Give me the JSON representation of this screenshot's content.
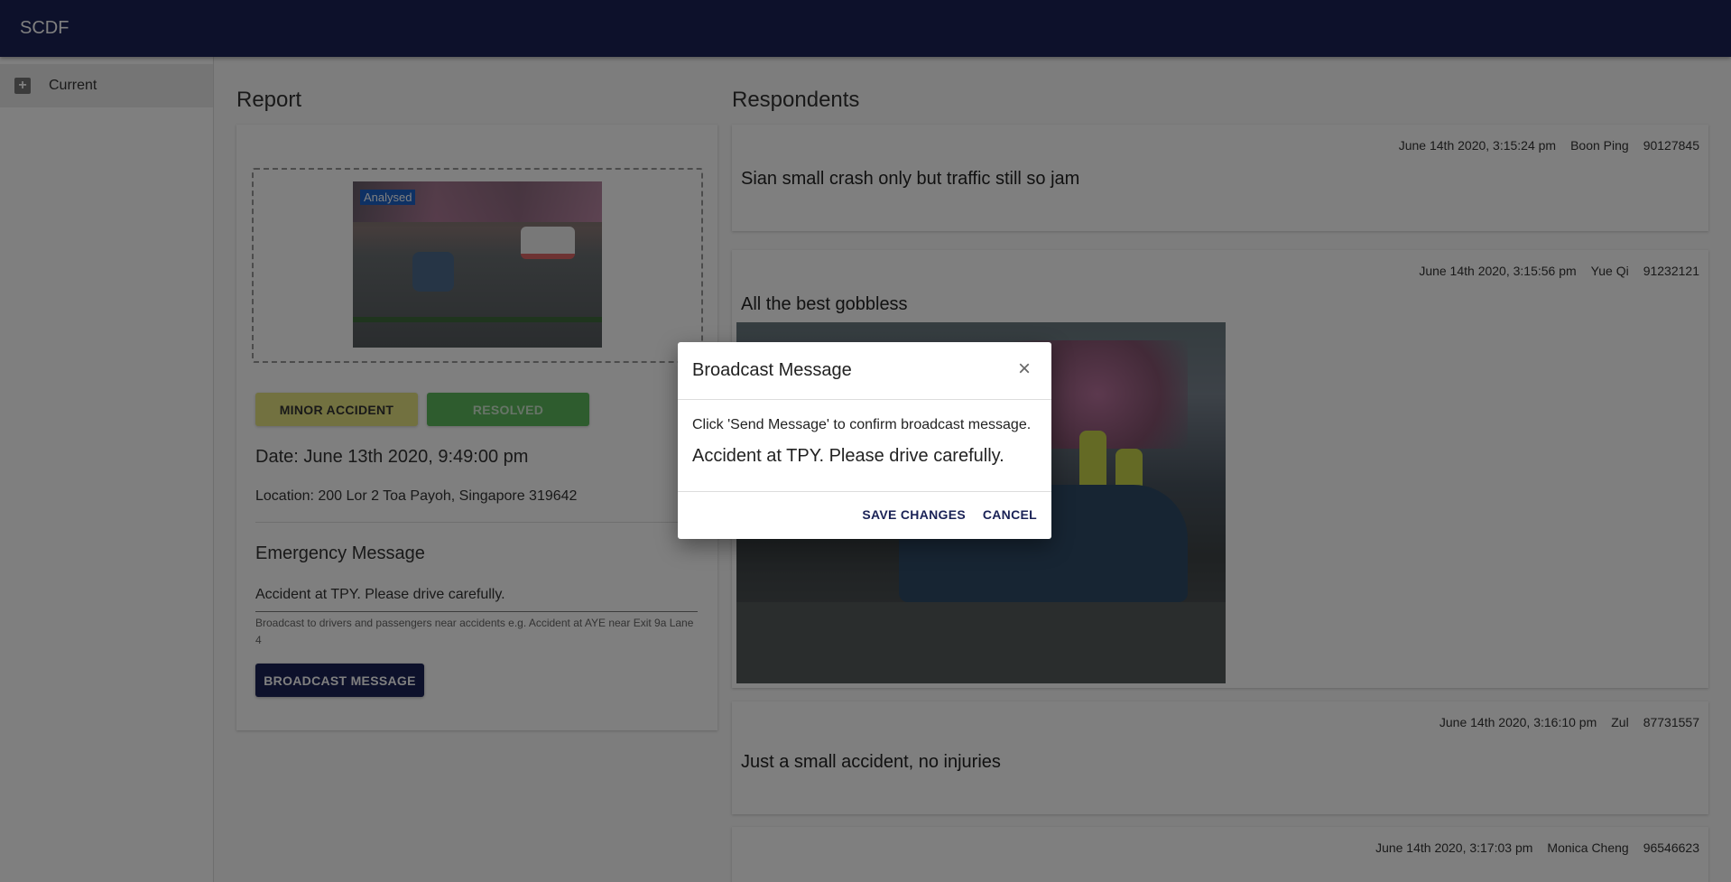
{
  "app": {
    "title": "SCDF"
  },
  "sidebar": {
    "items": [
      {
        "label": "Current",
        "icon": "plus-square-icon"
      }
    ]
  },
  "report": {
    "section_title": "Report",
    "image_badge": "Analysed",
    "chips": {
      "severity": "MINOR ACCIDENT",
      "status": "RESOLVED"
    },
    "date": "Date: June 13th 2020, 9:49:00 pm",
    "location": "Location: 200 Lor 2 Toa Payoh, Singapore 319642",
    "emergency_title": "Emergency Message",
    "emergency_value": "Accident at TPY. Please drive carefully.",
    "emergency_helper": "Broadcast to drivers and passengers near accidents e.g. Accident at AYE near Exit 9a Lane 4",
    "broadcast_button": "BROADCAST MESSAGE"
  },
  "respondents": {
    "section_title": "Respondents",
    "items": [
      {
        "time": "June 14th 2020, 3:15:24 pm",
        "name": "Boon Ping",
        "phone": "90127845",
        "message": "Sian small crash only but traffic still so jam"
      },
      {
        "time": "June 14th 2020, 3:15:56 pm",
        "name": "Yue Qi",
        "phone": "91232121",
        "message": "All the best gobbless"
      },
      {
        "time": "June 14th 2020, 3:16:10 pm",
        "name": "Zul",
        "phone": "87731557",
        "message": "Just a small accident, no injuries"
      },
      {
        "time": "June 14th 2020, 3:17:03 pm",
        "name": "Monica Cheng",
        "phone": "96546623",
        "message": ""
      }
    ]
  },
  "dialog": {
    "title": "Broadcast Message",
    "subtitle": "Click 'Send Message' to confirm broadcast message.",
    "message": "Accident at TPY. Please drive carefully.",
    "save_label": "SAVE CHANGES",
    "cancel_label": "CANCEL"
  },
  "colors": {
    "primary": "#1a2256",
    "minor_chip": "#e4e381",
    "resolved_chip": "#5cb85c",
    "analysed_badge": "#1d62c9"
  }
}
